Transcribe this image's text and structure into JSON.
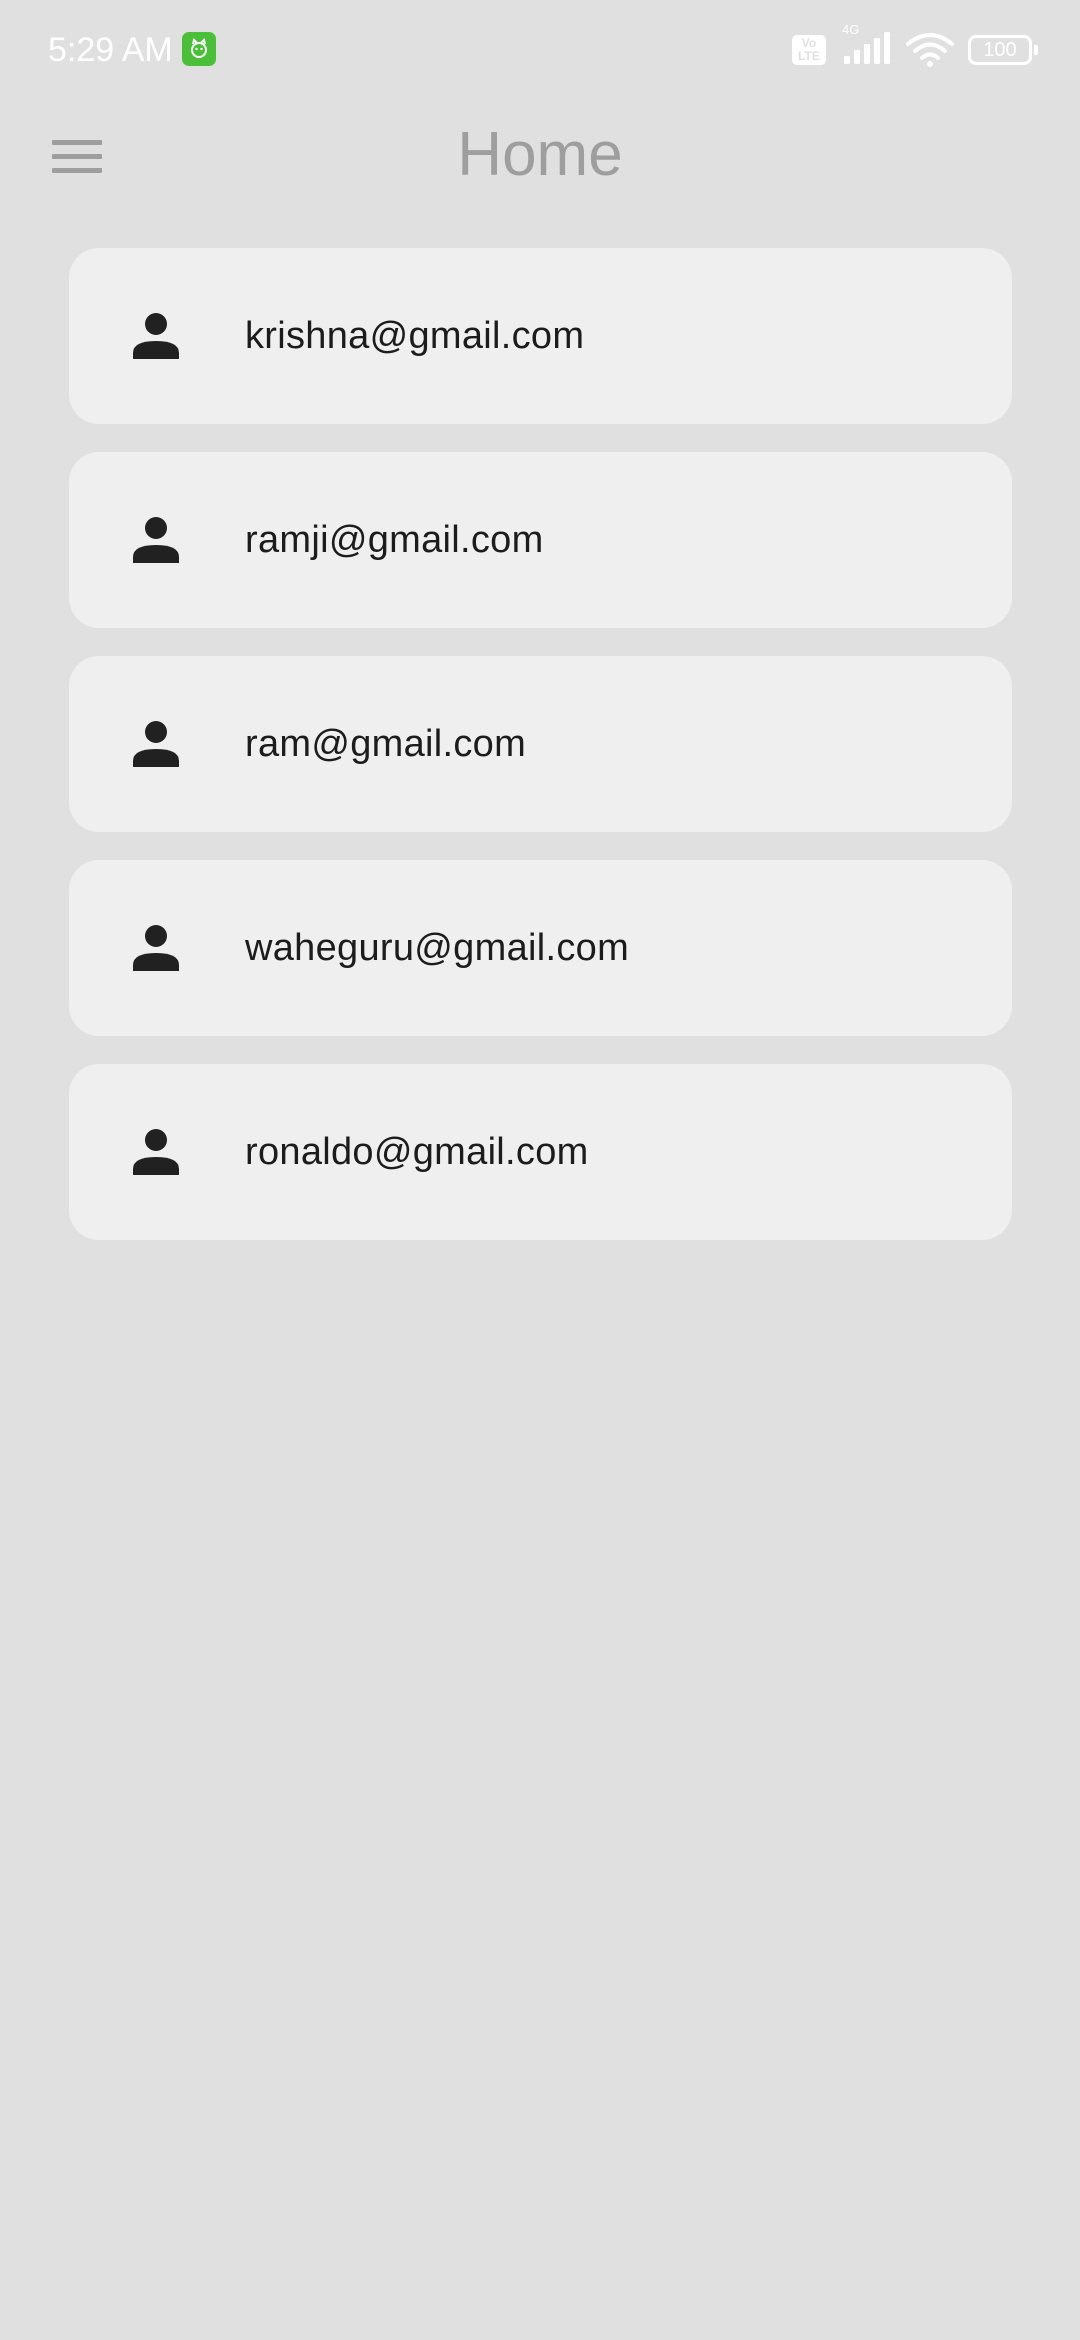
{
  "status_bar": {
    "time": "5:29 AM",
    "app_badge_icon": "cat-face-icon",
    "volte_label": "Vo LTE",
    "network_label": "4G",
    "battery_level": "100"
  },
  "app_bar": {
    "menu_icon": "hamburger-menu-icon",
    "title": "Home",
    "title_color": "#9e9e9e"
  },
  "users": [
    {
      "email": "krishna@gmail.com",
      "icon": "person-icon"
    },
    {
      "email": "ramji@gmail.com",
      "icon": "person-icon"
    },
    {
      "email": "ram@gmail.com",
      "icon": "person-icon"
    },
    {
      "email": "waheguru@gmail.com",
      "icon": "person-icon"
    },
    {
      "email": "ronaldo@gmail.com",
      "icon": "person-icon"
    }
  ],
  "colors": {
    "background": "#e0e0e0",
    "card": "#efefef",
    "text": "#1c1c1c",
    "badge": "#4cbf3a"
  }
}
